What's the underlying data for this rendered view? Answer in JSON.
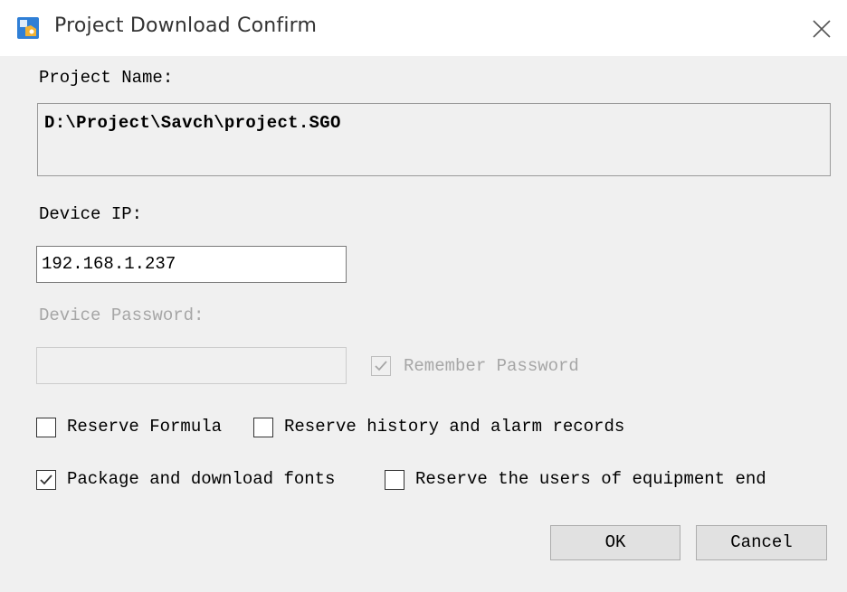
{
  "window": {
    "title": "Project Download Confirm",
    "icon": "app-icon",
    "close_icon": "close-icon"
  },
  "project": {
    "label": "Project Name:",
    "path": "D:\\Project\\Savch\\project.SGO"
  },
  "device_ip": {
    "label": "Device IP:",
    "value": "192.168.1.237"
  },
  "device_password": {
    "label": "Device Password:",
    "value": "",
    "enabled": false
  },
  "remember_password": {
    "label": "Remember Password",
    "checked": true,
    "enabled": false
  },
  "options": {
    "reserve_formula": {
      "label": "Reserve Formula",
      "checked": false
    },
    "reserve_history": {
      "label": "Reserve history and alarm records",
      "checked": false
    },
    "package_fonts": {
      "label": "Package and download fonts",
      "checked": true
    },
    "reserve_users": {
      "label": "Reserve the users of equipment end",
      "checked": false
    }
  },
  "buttons": {
    "ok": "OK",
    "cancel": "Cancel"
  },
  "colors": {
    "dialog_background": "#f0f0f0",
    "titlebar_background": "#ffffff",
    "disabled_text": "#a6a6a6",
    "button_face": "#e1e1e1"
  }
}
